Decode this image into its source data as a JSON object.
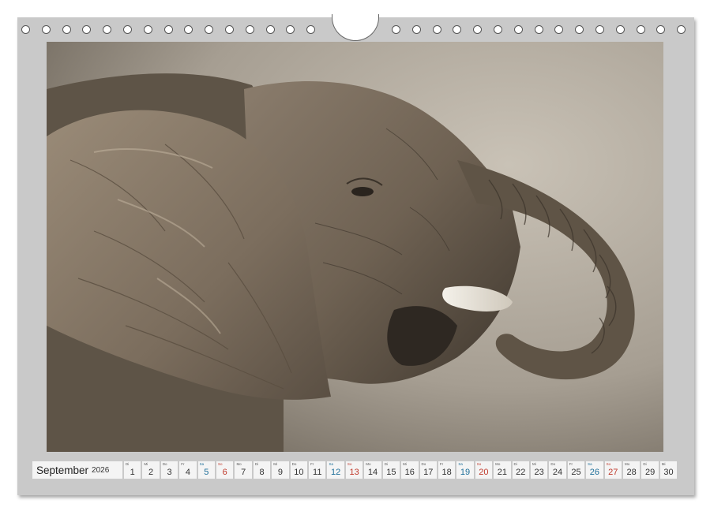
{
  "calendar": {
    "month": "September",
    "year": "2026",
    "days": [
      {
        "wd": "Di",
        "num": "1",
        "type": "weekday"
      },
      {
        "wd": "Mi",
        "num": "2",
        "type": "weekday"
      },
      {
        "wd": "Do",
        "num": "3",
        "type": "weekday"
      },
      {
        "wd": "Fr",
        "num": "4",
        "type": "weekday"
      },
      {
        "wd": "Sa",
        "num": "5",
        "type": "sat"
      },
      {
        "wd": "So",
        "num": "6",
        "type": "sun"
      },
      {
        "wd": "Mo",
        "num": "7",
        "type": "weekday"
      },
      {
        "wd": "Di",
        "num": "8",
        "type": "weekday"
      },
      {
        "wd": "Mi",
        "num": "9",
        "type": "weekday"
      },
      {
        "wd": "Do",
        "num": "10",
        "type": "weekday"
      },
      {
        "wd": "Fr",
        "num": "11",
        "type": "weekday"
      },
      {
        "wd": "Sa",
        "num": "12",
        "type": "sat"
      },
      {
        "wd": "So",
        "num": "13",
        "type": "sun"
      },
      {
        "wd": "Mo",
        "num": "14",
        "type": "weekday"
      },
      {
        "wd": "Di",
        "num": "15",
        "type": "weekday"
      },
      {
        "wd": "Mi",
        "num": "16",
        "type": "weekday"
      },
      {
        "wd": "Do",
        "num": "17",
        "type": "weekday"
      },
      {
        "wd": "Fr",
        "num": "18",
        "type": "weekday"
      },
      {
        "wd": "Sa",
        "num": "19",
        "type": "sat"
      },
      {
        "wd": "So",
        "num": "20",
        "type": "sun"
      },
      {
        "wd": "Mo",
        "num": "21",
        "type": "weekday"
      },
      {
        "wd": "Di",
        "num": "22",
        "type": "weekday"
      },
      {
        "wd": "Mi",
        "num": "23",
        "type": "weekday"
      },
      {
        "wd": "Do",
        "num": "24",
        "type": "weekday"
      },
      {
        "wd": "Fr",
        "num": "25",
        "type": "weekday"
      },
      {
        "wd": "Sa",
        "num": "26",
        "type": "sat"
      },
      {
        "wd": "So",
        "num": "27",
        "type": "sun"
      },
      {
        "wd": "Mo",
        "num": "28",
        "type": "weekday"
      },
      {
        "wd": "Di",
        "num": "29",
        "type": "weekday"
      },
      {
        "wd": "Mi",
        "num": "30",
        "type": "weekday"
      }
    ]
  },
  "photo": {
    "subject": "elephant-icon"
  },
  "colors": {
    "page": "#c9c9c9",
    "saturday": "#1e6f9a",
    "sunday": "#c0392b"
  }
}
